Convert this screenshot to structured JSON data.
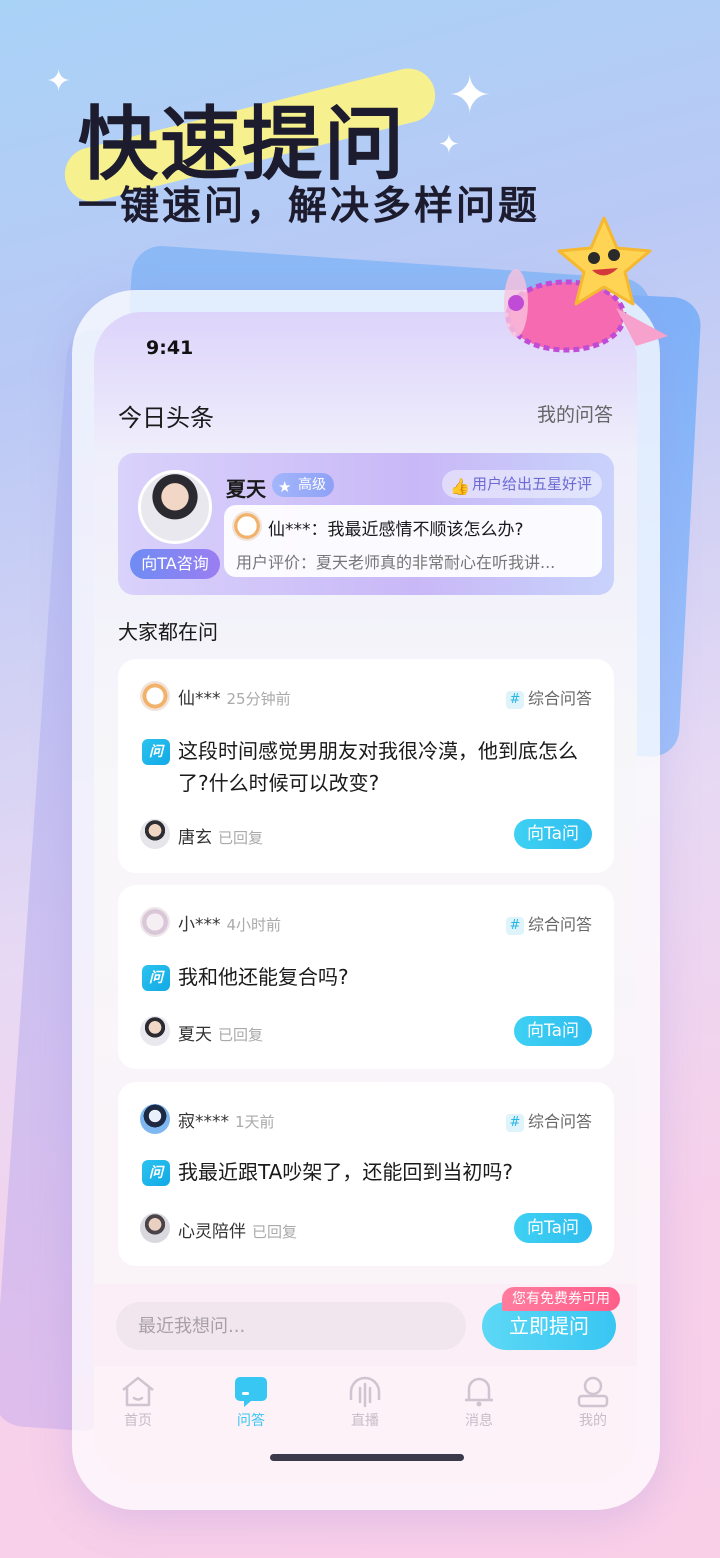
{
  "hero": {
    "title": "快速提问",
    "subtitle": "一键速问，解决多样问题"
  },
  "status_bar": {
    "time": "9:41"
  },
  "header": {
    "title": "今日头条",
    "my_questions": "我的问答"
  },
  "featured": {
    "name": "夏天",
    "level": "高级",
    "badge": "用户给出五星好评",
    "consult_button": "向TA咨询",
    "question": "仙***：我最近感情不顺该怎么办?",
    "review": "用户评价：夏天老师真的非常耐心在听我讲..."
  },
  "section_title": "大家都在问",
  "questions": [
    {
      "user": "仙***",
      "time": "25分钟前",
      "tag": "综合问答",
      "question": "这段时间感觉男朋友对我很冷漠，他到底怎么了?什么时候可以改变?",
      "answerer": "唐玄",
      "status": "已回复",
      "ask_button": "向Ta问"
    },
    {
      "user": "小***",
      "time": "4小时前",
      "tag": "综合问答",
      "question": "我和他还能复合吗?",
      "answerer": "夏天",
      "status": "已回复",
      "ask_button": "向Ta问"
    },
    {
      "user": "寂****",
      "time": "1天前",
      "tag": "综合问答",
      "question": "我最近跟TA吵架了，还能回到当初吗?",
      "answerer": "心灵陪伴",
      "status": "已回复",
      "ask_button": "向Ta问"
    }
  ],
  "bottom_bar": {
    "input_placeholder": "最近我想问...",
    "ask_button": "立即提问",
    "coupon": "您有免费券可用"
  },
  "tabs": [
    {
      "label": "首页",
      "icon": "home-icon",
      "active": false
    },
    {
      "label": "问答",
      "icon": "chat-icon",
      "active": true
    },
    {
      "label": "直播",
      "icon": "live-icon",
      "active": false
    },
    {
      "label": "消息",
      "icon": "bell-icon",
      "active": false
    },
    {
      "label": "我的",
      "icon": "profile-icon",
      "active": false
    }
  ],
  "colors": {
    "accent": "#38c6f2",
    "featured_bg": "#c9b8f7",
    "coupon": "#ff5d8a"
  }
}
